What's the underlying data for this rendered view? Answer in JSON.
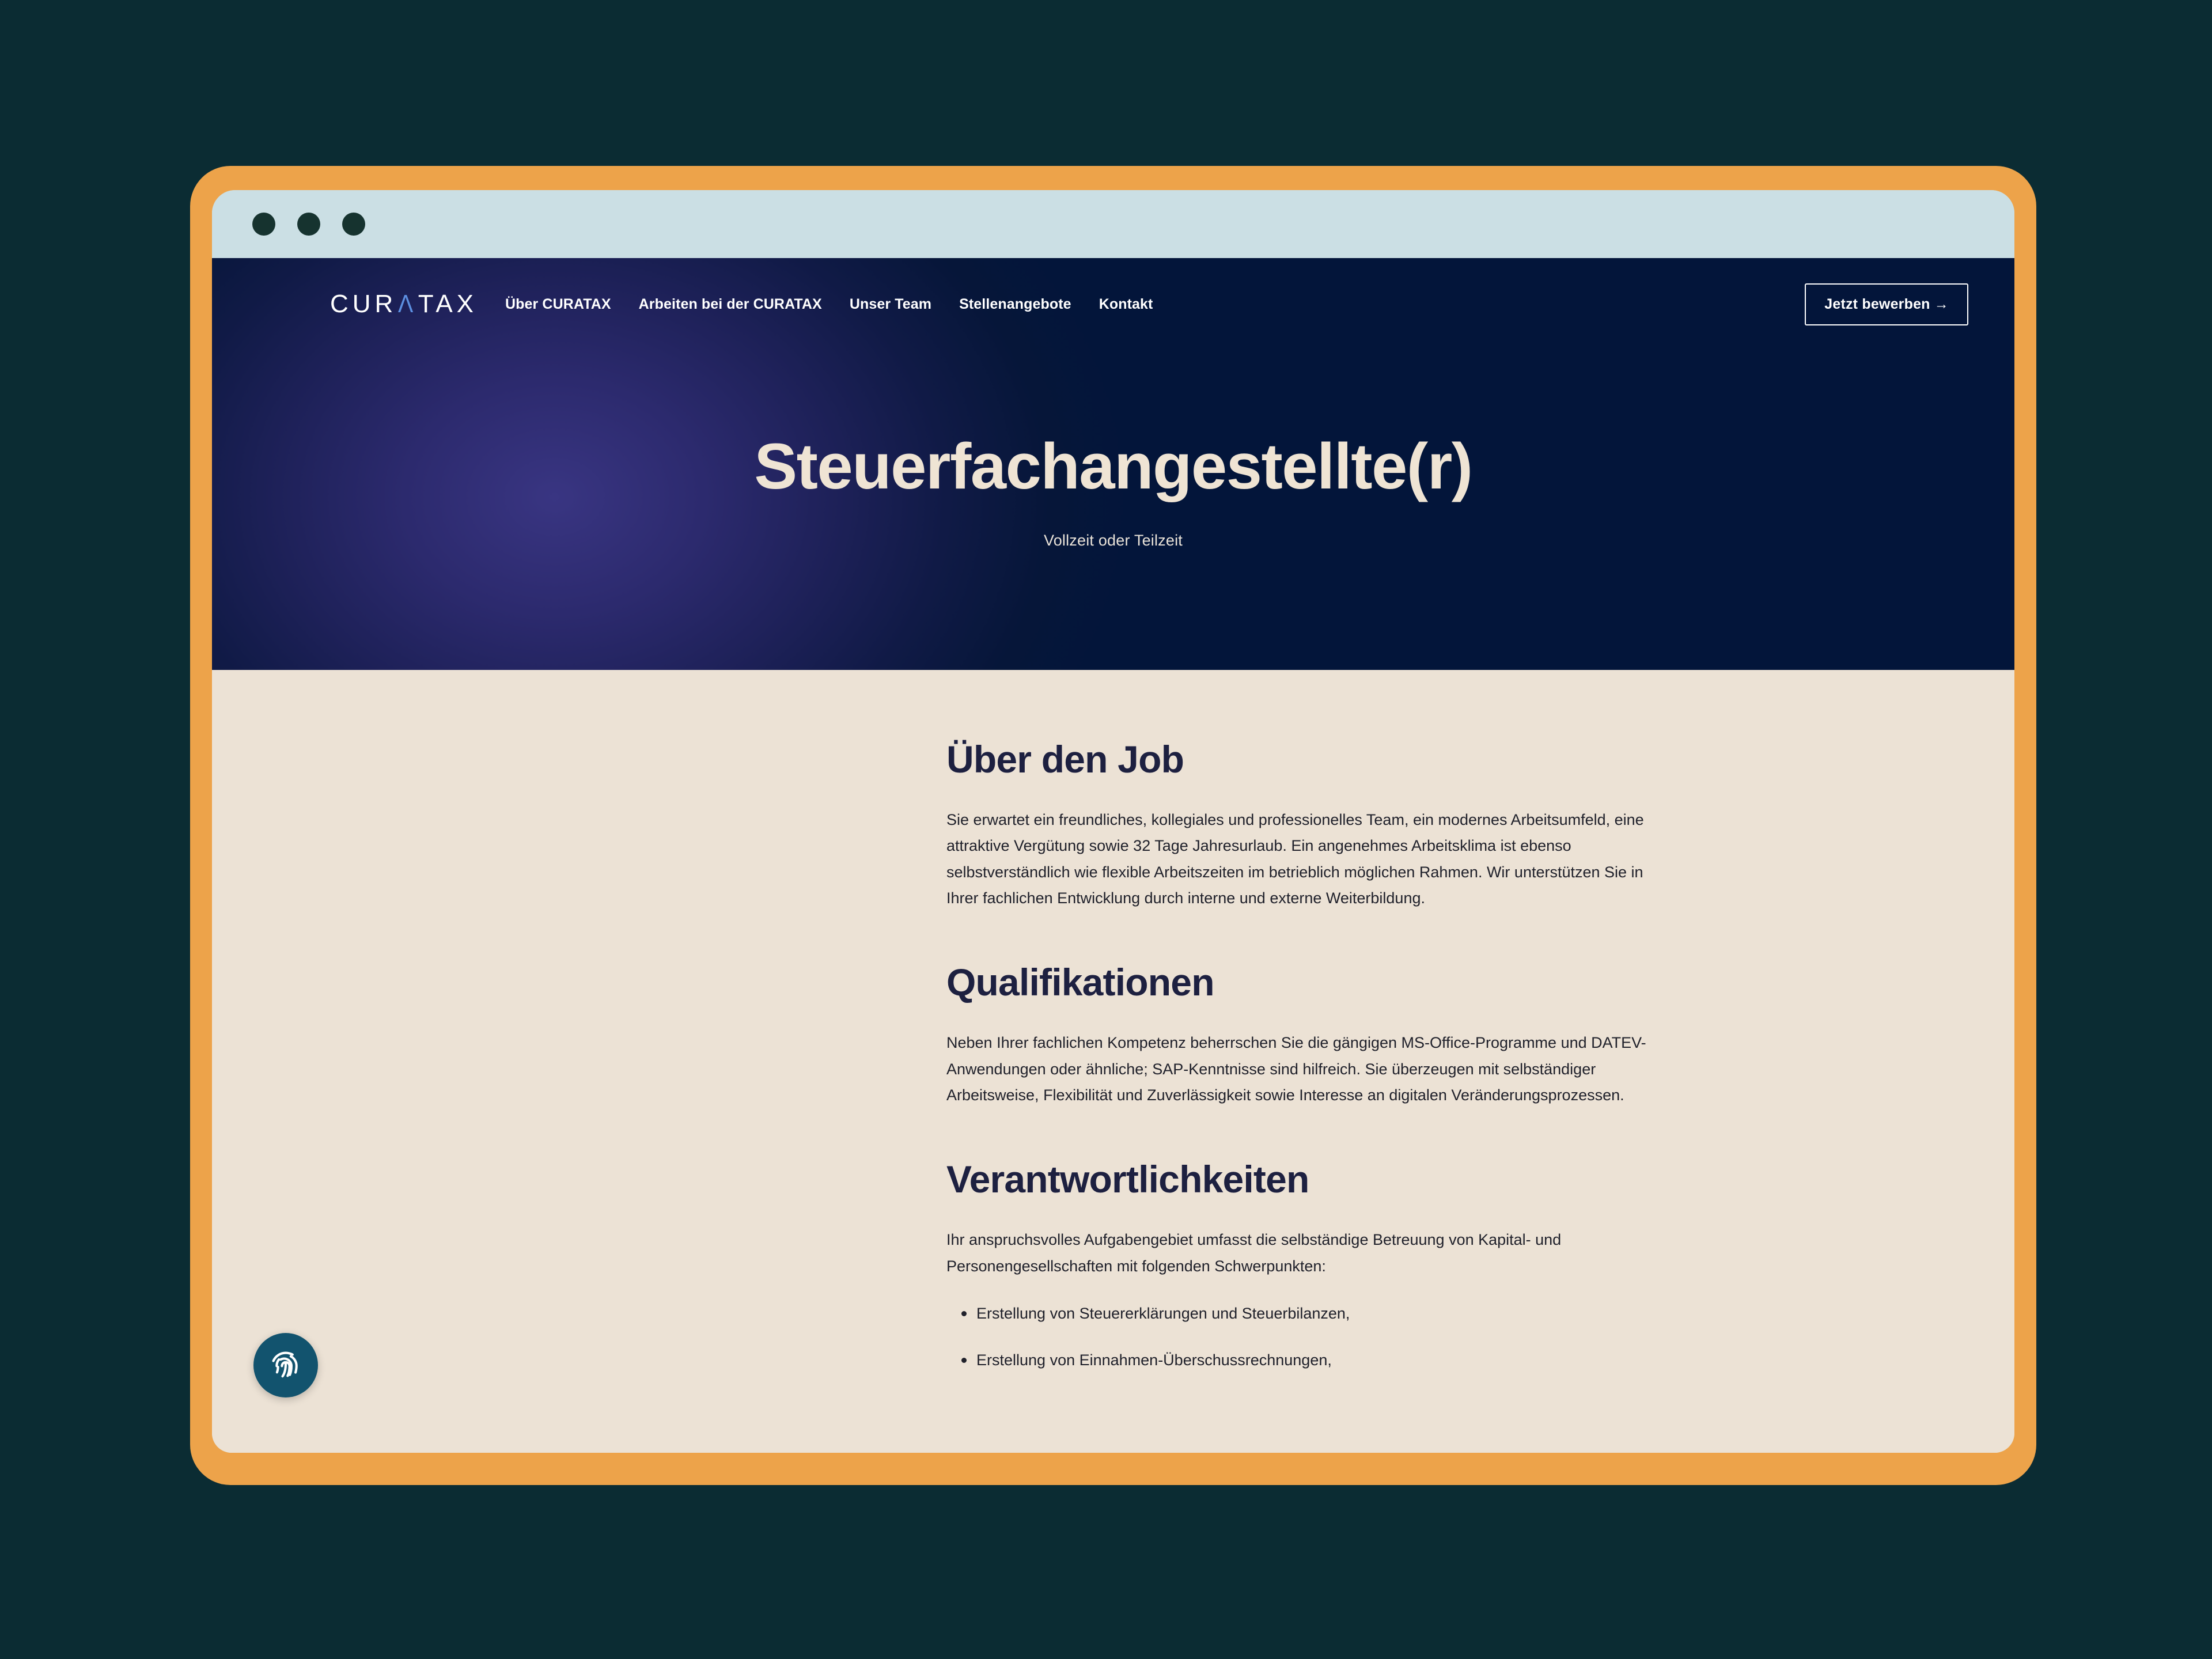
{
  "window": {
    "dots": [
      "close-dot",
      "minimize-dot",
      "maximize-dot"
    ]
  },
  "colors": {
    "page_background": "#0b2c33",
    "frame_orange": "#eda34a",
    "titlebar": "#cbdfe4",
    "hero_navy": "#03163a",
    "hero_purple": "#2d2a6e",
    "content_cream": "#ece2d5",
    "heading_navy": "#1d2040",
    "logo_accent_blue": "#5c8fe0",
    "fab_teal": "#12536e"
  },
  "nav": {
    "logo": {
      "part1": "CUR",
      "accent": "Λ",
      "part2": "TAX",
      "full": "CURATAX"
    },
    "links": [
      {
        "label": "Über CURATAX"
      },
      {
        "label": "Arbeiten bei der CURATAX"
      },
      {
        "label": "Unser Team"
      },
      {
        "label": "Stellenangebote"
      },
      {
        "label": "Kontakt"
      }
    ],
    "cta": {
      "label": "Jetzt bewerben →"
    }
  },
  "hero": {
    "title": "Steuerfachangestellte(r)",
    "subtitle": "Vollzeit oder Teilzeit"
  },
  "content": {
    "sections": [
      {
        "heading": "Über den Job",
        "paragraph": "Sie erwartet ein freundliches, kollegiales und professionelles Team, ein modernes Arbeitsumfeld, eine attraktive Vergütung sowie 32 Tage Jahresurlaub. Ein angenehmes Arbeitsklima ist ebenso selbstverständlich wie flexible Arbeitszeiten im betrieblich möglichen Rahmen. Wir unterstützen Sie in Ihrer fachlichen Entwicklung durch interne und externe Weiterbildung."
      },
      {
        "heading": "Qualifikationen",
        "paragraph": "Neben Ihrer fachlichen Kompetenz beherrschen Sie die gängigen MS-Office-Programme und DATEV-Anwendungen oder ähnliche; SAP-Kenntnisse sind hilfreich. Sie überzeugen mit selbständiger Arbeitsweise, Flexibilität und Zuverlässigkeit sowie Interesse an digitalen Veränderungsprozessen."
      },
      {
        "heading": "Verantwortlichkeiten",
        "paragraph": "Ihr anspruchsvolles Aufgabengebiet umfasst die selbständige Betreuung von Kapital- und Personengesellschaften mit folgenden Schwerpunkten:",
        "bullets": [
          "Erstellung von Steuererklärungen und Steuerbilanzen,",
          "Erstellung von Einnahmen-Überschussrechnungen,"
        ]
      }
    ]
  },
  "privacy_widget": {
    "icon": "fingerprint-icon"
  }
}
